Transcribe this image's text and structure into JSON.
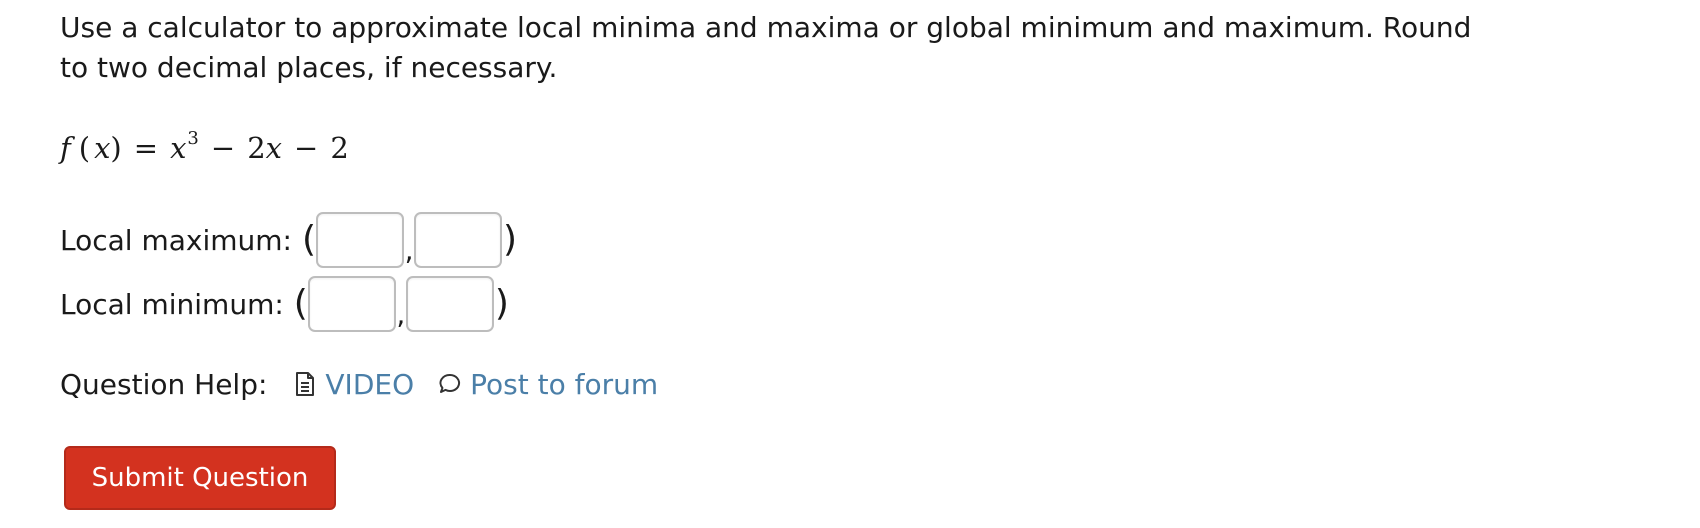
{
  "question": {
    "prompt": "Use a calculator to approximate local minima and maxima or global minimum and maximum. Round to two decimal places, if necessary.",
    "formula": {
      "lhs_f": "f",
      "lhs_var": "x",
      "rhs_var": "x",
      "exponent": "3",
      "term2_coef": "2",
      "term2_var": "x",
      "constant": "2"
    }
  },
  "answers": {
    "local_max": {
      "label": "Local maximum:",
      "x_value": "",
      "y_value": ""
    },
    "local_min": {
      "label": "Local minimum:",
      "x_value": "",
      "y_value": ""
    },
    "open_paren": "(",
    "close_paren": ")",
    "comma": ","
  },
  "help": {
    "label": "Question Help:",
    "video_label": "VIDEO",
    "video_icon": "document-icon",
    "forum_label": "Post to forum",
    "forum_icon": "speech-bubble-icon",
    "link_color": "#4b7fa8"
  },
  "submit": {
    "label": "Submit Question",
    "color": "#d3321f"
  }
}
